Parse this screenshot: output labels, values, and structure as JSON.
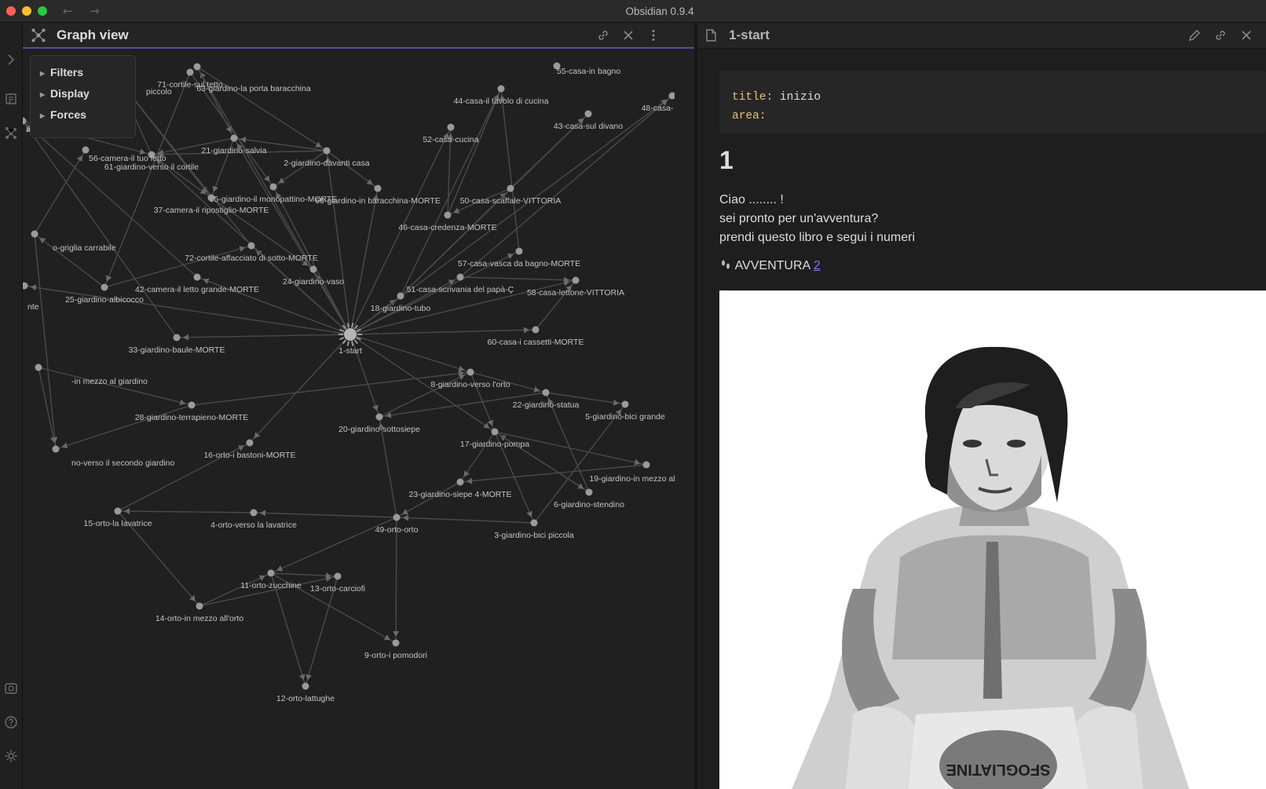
{
  "window": {
    "app_title": "Obsidian 0.9.4",
    "back_arrow": "←",
    "forward_arrow": "→"
  },
  "graph_pane": {
    "title": "Graph view",
    "settings": [
      "Filters",
      "Display",
      "Forces"
    ]
  },
  "graph": {
    "nodes": [
      {
        "id": "1",
        "label": "1-start"
      },
      {
        "id": "2",
        "label": "2-giardino-davanti casa"
      },
      {
        "id": "3",
        "label": "3-giardino-bici piccola"
      },
      {
        "id": "4",
        "label": "4-orto-verso la lavatrice"
      },
      {
        "id": "5",
        "label": "5-giardino-bici grande"
      },
      {
        "id": "6",
        "label": "6-giardino-stendino"
      },
      {
        "id": "8",
        "label": "8-giardino-verso l'orto"
      },
      {
        "id": "9",
        "label": "9-orto-i pomodori"
      },
      {
        "id": "11",
        "label": "11-orto-zucchine"
      },
      {
        "id": "12",
        "label": "12-orto-lattughe"
      },
      {
        "id": "13",
        "label": "13-orto-carciofi"
      },
      {
        "id": "14",
        "label": "14-orto-in mezzo all'orto"
      },
      {
        "id": "15",
        "label": "15-orto-la lavatrice"
      },
      {
        "id": "16",
        "label": "16-orto-i bastoni-MORTE"
      },
      {
        "id": "17",
        "label": "17-giardino-pompa"
      },
      {
        "id": "18",
        "label": "18-giardino-tubo"
      },
      {
        "id": "19",
        "label": "19-giardino-in mezzo al"
      },
      {
        "id": "20",
        "label": "20-giardino-sottosiepe"
      },
      {
        "id": "21",
        "label": "21-giardino-salvia"
      },
      {
        "id": "22",
        "label": "22-giardino-statua"
      },
      {
        "id": "23",
        "label": "23-giardino-siepe 4-MORTE"
      },
      {
        "id": "24",
        "label": "24-giardino-vaso"
      },
      {
        "id": "25",
        "label": "25-giardino-albicocco"
      },
      {
        "id": "28",
        "label": "28-giardino-terrapieno-MORTE"
      },
      {
        "id": "33",
        "label": "33-giardino-baule-MORTE"
      },
      {
        "id": "35",
        "label": "35-giardino-il monopattino-MORTE"
      },
      {
        "id": "37",
        "label": "37-camera-il ripostiglio-MORTE"
      },
      {
        "id": "42",
        "label": "42-camera-il letto grande-MORTE"
      },
      {
        "id": "43",
        "label": "43-casa-sul divano"
      },
      {
        "id": "44",
        "label": "44-casa-il tavolo di cucina"
      },
      {
        "id": "46",
        "label": "46-casa-credenza-MORTE"
      },
      {
        "id": "48",
        "label": "48-casa-"
      },
      {
        "id": "49",
        "label": "49-orto-orto"
      },
      {
        "id": "50",
        "label": "50-casa-scaffale-VITTORIA"
      },
      {
        "id": "51",
        "label": "51-casa-scrivania del papà-Ç"
      },
      {
        "id": "52",
        "label": "52-casa-cucina"
      },
      {
        "id": "57",
        "label": "57-casa-vasca da bagno-MORTE"
      },
      {
        "id": "58",
        "label": "58-casa-lettone-VITTORIA"
      },
      {
        "id": "60",
        "label": "60-casa-i cassetti-MORTE"
      },
      {
        "id": "61",
        "label": "61-giardino-verso il cortile"
      },
      {
        "id": "63",
        "label": "63-giardino-la porta baracchina"
      },
      {
        "id": "66",
        "label": "66-giardino-in baracchina-MORTE"
      },
      {
        "id": "71",
        "label": "71-cortile-sul tetto"
      },
      {
        "id": "72",
        "label": "72-cortile-affacciato di sotto-MORTE"
      },
      {
        "id": "g1",
        "label": "o-griglia carrabile"
      },
      {
        "id": "g2",
        "label": "-in mezzo al giardino"
      },
      {
        "id": "g3",
        "label": "no-verso il secondo giardino"
      },
      {
        "id": "g4",
        "label": "nte"
      },
      {
        "id": "g5",
        "label": "piccolo"
      },
      {
        "id": "g6",
        "label": "ar"
      },
      {
        "id": "g7",
        "label": "56-camera-il tuo letto"
      },
      {
        "id": "g8",
        "label": "55-casa-in bagno"
      }
    ]
  },
  "note_pane": {
    "title": "1-start",
    "frontmatter": [
      {
        "key": "title",
        "value": "inizio"
      },
      {
        "key": "area",
        "value": ""
      }
    ],
    "heading": "1",
    "body_lines": [
      "Ciao ........ !",
      "sei pronto per un'avventura?",
      "prendi questo libro e segui i numeri"
    ],
    "link_prefix": "AVVENTURA",
    "link_text": "2",
    "image_caption_text": "SFOGLIATINE"
  },
  "colors": {
    "accent": "#7f6df2",
    "node": "#9a9a9a",
    "edge": "#4a4a4a",
    "background": "#202020"
  }
}
